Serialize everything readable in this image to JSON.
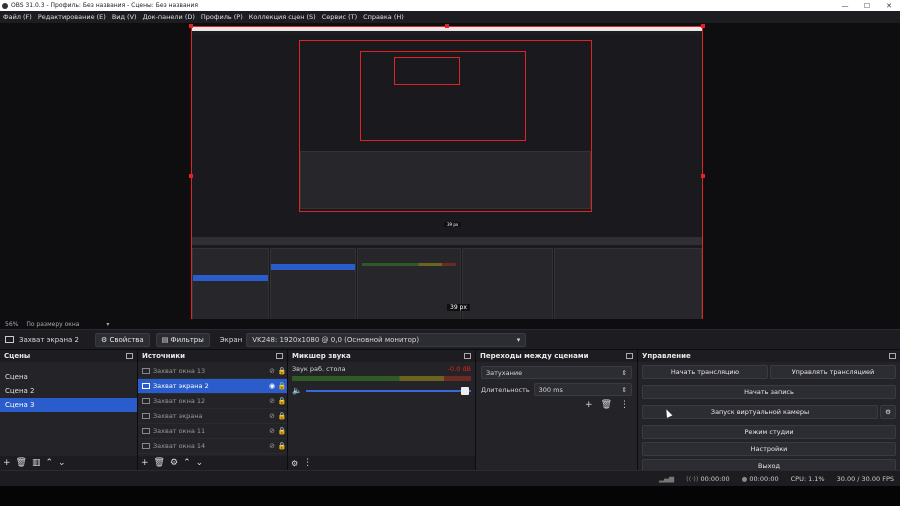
{
  "window": {
    "title": "OBS 31.0.3 - Профиль: Без названия - Сцены: Без названия"
  },
  "menu": [
    "Файл (F)",
    "Редактирование (E)",
    "Вид (V)",
    "Док-панели (D)",
    "Профиль (P)",
    "Коллекция сцен (S)",
    "Сервис (T)",
    "Справка (H)"
  ],
  "preview": {
    "size_label": "39 px",
    "nested_size_label": "39 px"
  },
  "zoom": {
    "value": "56%",
    "mode": "По размеру окна"
  },
  "source_toolbar": {
    "source_name": "Захват экрана 2",
    "properties_label": "Свойства",
    "filters_label": "Фильтры",
    "screen_label": "Экран",
    "screen_value": "VK248: 1920x1080 @ 0,0 (Основной монитор)"
  },
  "scenes": {
    "title": "Сцены",
    "items": [
      "Сцена",
      "Сцена 2",
      "Сцена 3"
    ],
    "active_index": 2
  },
  "sources": {
    "title": "Источники",
    "items": [
      "Захват окна 13",
      "Захват экрана 2",
      "Захват окна 12",
      "Захват экрана",
      "Захват окна 11",
      "Захват окна 14"
    ],
    "active_index": 1
  },
  "mixer": {
    "title": "Микшер звука",
    "track_name": "Звук раб. стола",
    "level": "-0.0 dB"
  },
  "transitions": {
    "title": "Переходы между сценами",
    "selected": "Затухание",
    "duration_label": "Длительность",
    "duration_value": "300 ms"
  },
  "controls": {
    "title": "Управление",
    "start_stream": "Начать трансляцию",
    "manage_stream": "Управлять трансляцией",
    "start_record": "Начать запись",
    "virtual_cam": "Запуск виртуальной камеры",
    "studio_mode": "Режим студии",
    "settings": "Настройки",
    "exit": "Выход"
  },
  "status": {
    "stream_time": "00:00:00",
    "record_time": "00:00:00",
    "cpu": "CPU: 1.1%",
    "fps": "30.00 / 30.00 FPS"
  },
  "colors": {
    "accent": "#2b5ccb",
    "selection": "#e02424"
  }
}
